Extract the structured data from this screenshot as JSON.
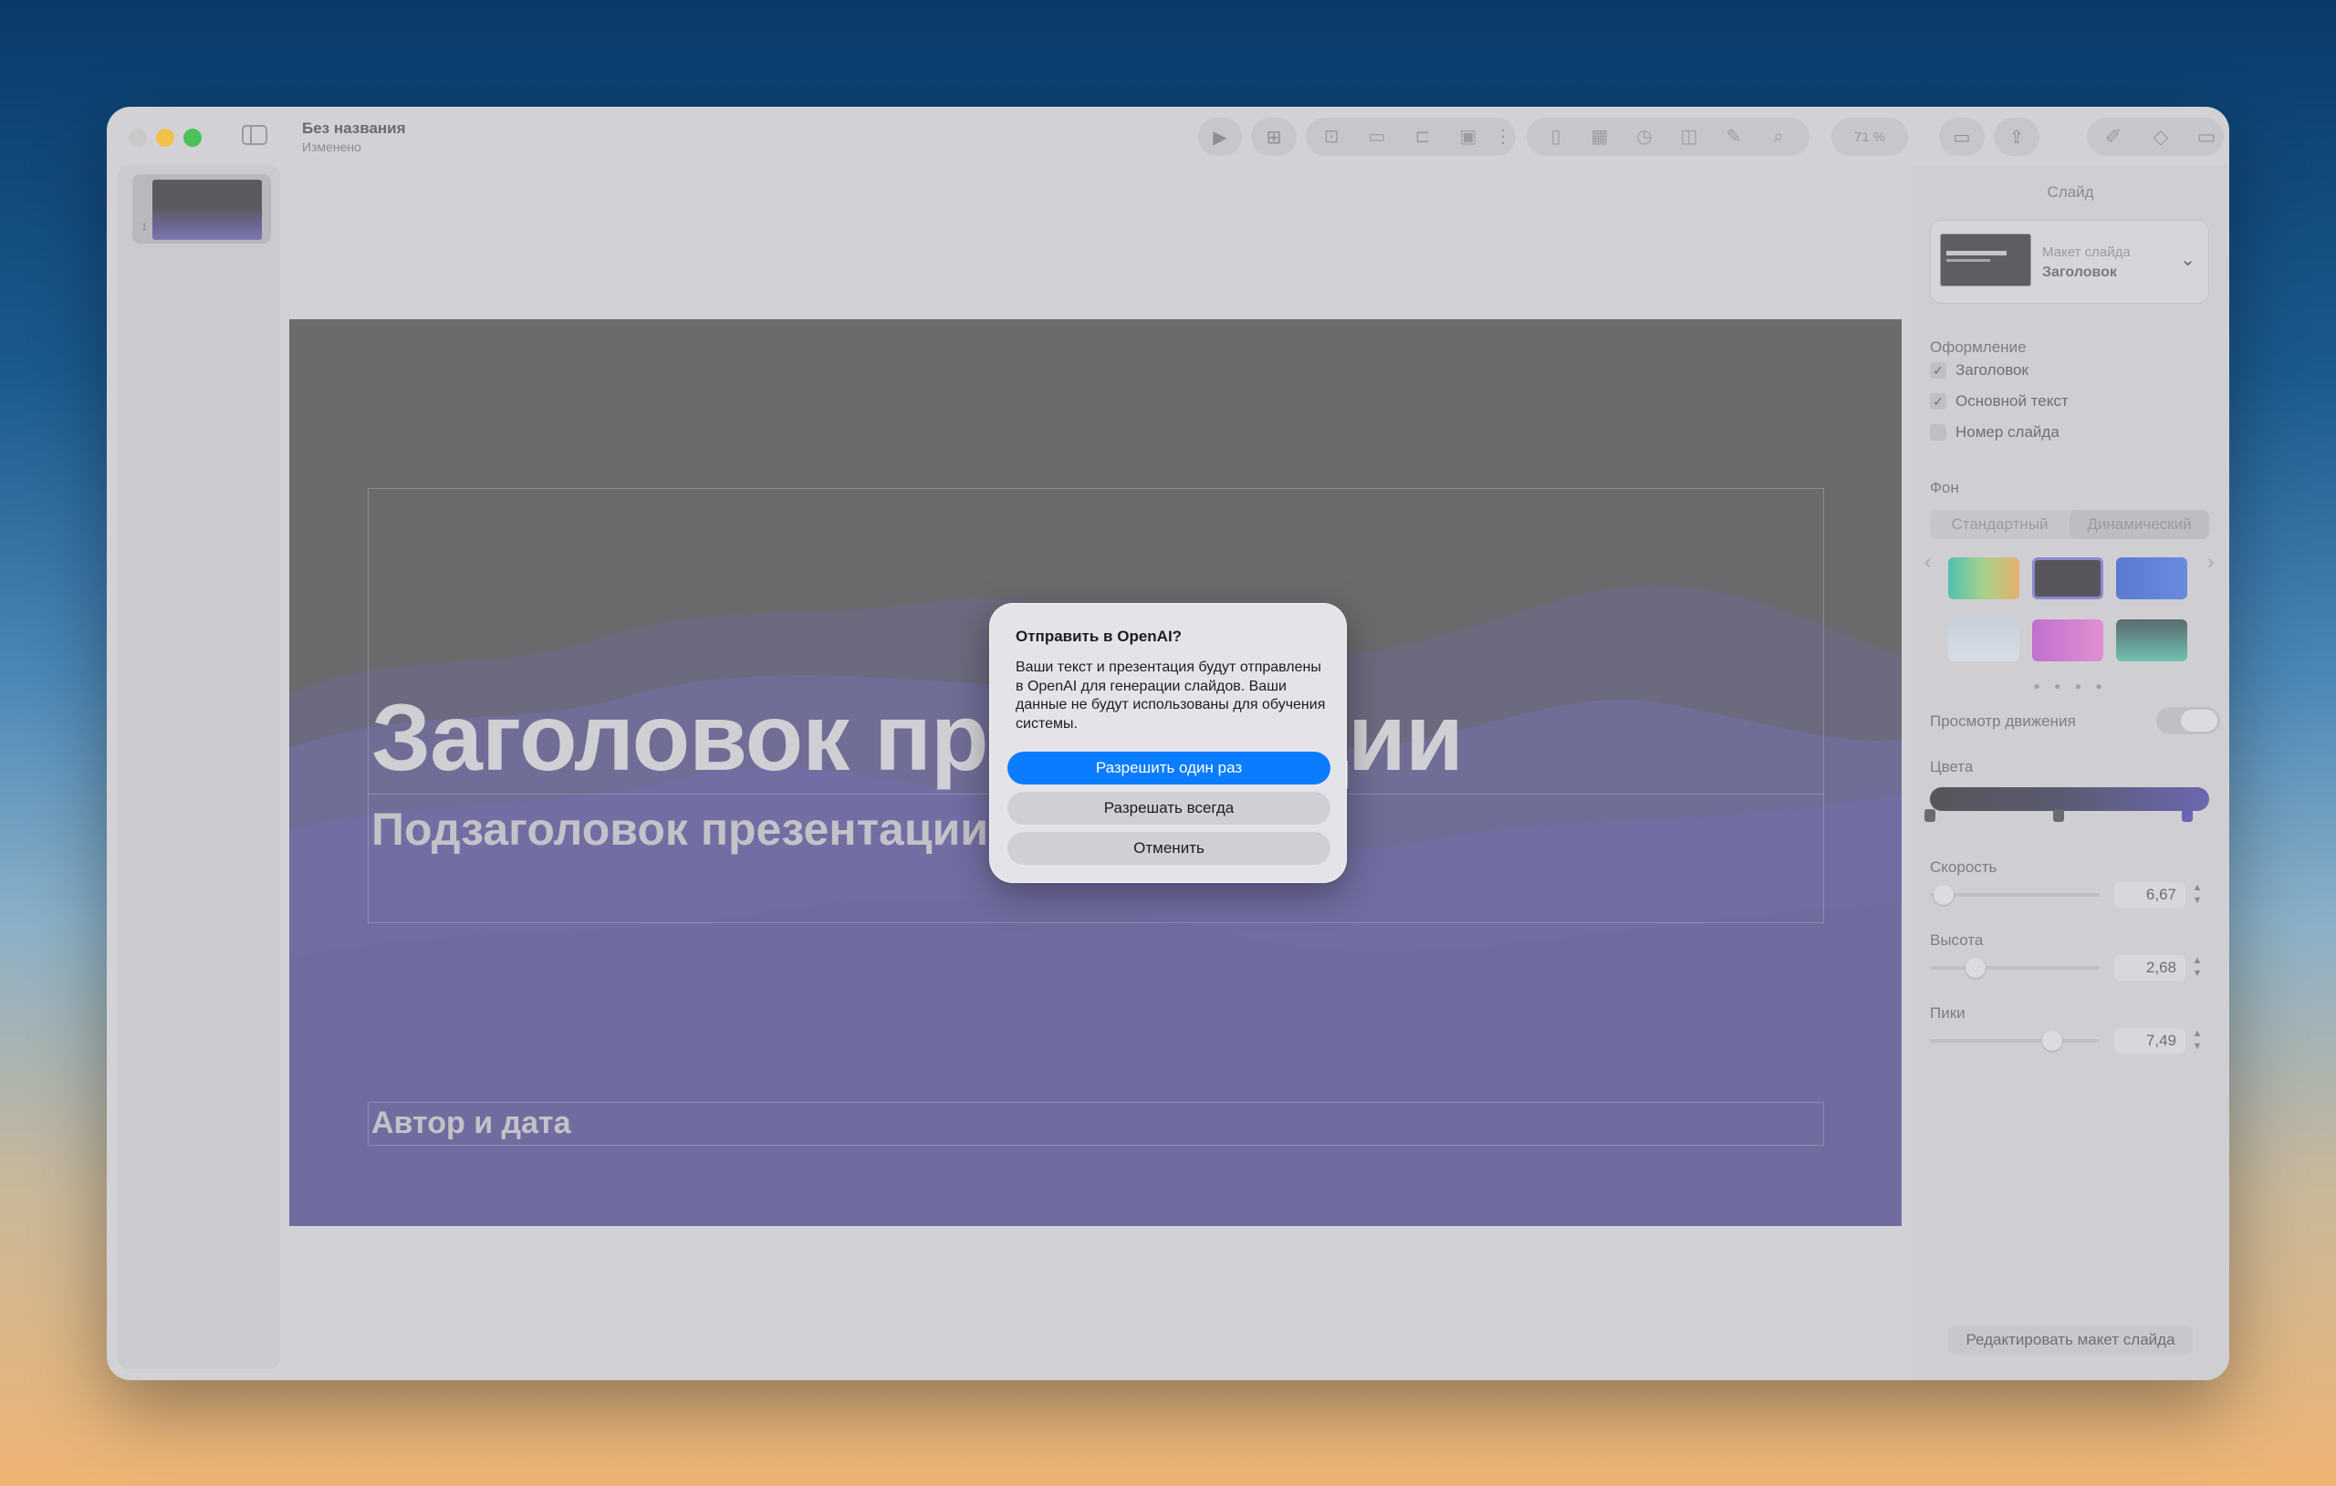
{
  "window": {
    "doc_title": "Без названия",
    "doc_status": "Изменено",
    "zoom": "71 %"
  },
  "slides_panel": {
    "items": [
      {
        "number": "1"
      }
    ]
  },
  "slide": {
    "title": "Заголовок презентации",
    "subtitle": "Подзаголовок презентации",
    "author": "Автор и дата"
  },
  "inspector": {
    "header": "Слайд",
    "layout": {
      "label": "Макет слайда",
      "value": "Заголовок"
    },
    "appearance": {
      "label": "Оформление",
      "options": [
        {
          "label": "Заголовок",
          "checked": true
        },
        {
          "label": "Основной текст",
          "checked": true
        },
        {
          "label": "Номер слайда",
          "checked": false
        }
      ]
    },
    "background": {
      "label": "Фон",
      "tabs": [
        "Стандартный",
        "Динамический"
      ],
      "active_tab": "Динамический",
      "page_dots": "● ● ● ●"
    },
    "motion_preview": {
      "label": "Просмотр движения"
    },
    "colors": {
      "label": "Цвета"
    },
    "speed": {
      "label": "Скорость",
      "value": "6,67",
      "level": 0.08
    },
    "height": {
      "label": "Высота",
      "value": "2,68",
      "level": 0.27
    },
    "peaks": {
      "label": "Пики",
      "value": "7,49",
      "level": 0.72
    },
    "edit_layout_button": "Редактировать макет слайда"
  },
  "dialog": {
    "title": "Отправить в OpenAI?",
    "body": "Ваши текст и презентация будут отправлены в OpenAI для генерации слайдов. Ваши данные не будут использованы для обучения системы.",
    "buttons": {
      "allow_once": "Разрешить один раз",
      "allow_always": "Разрешать всегда",
      "cancel": "Отменить"
    }
  },
  "colors": {
    "primary_button": "#0a7cff",
    "slide_wave": "#7670b0"
  }
}
